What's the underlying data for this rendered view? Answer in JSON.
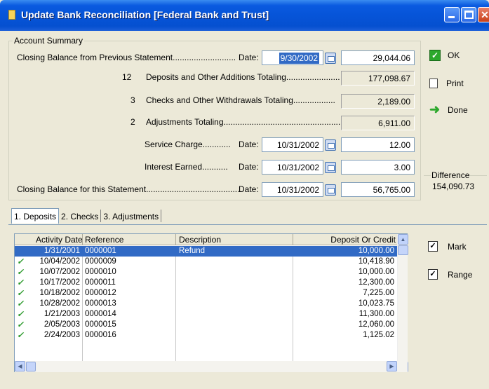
{
  "window": {
    "title": "Update Bank Reconciliation [Federal Bank and Trust]"
  },
  "summary": {
    "group_label": "Account Summary",
    "closing_prev_label": "Closing Balance from Previous Statement...........................",
    "date_label": "Date:",
    "closing_prev_date": "9/30/2002",
    "closing_prev_amount": "29,044.06",
    "deposits_count": "12",
    "deposits_label": "Deposits and Other Additions Totaling.......................",
    "deposits_total": "177,098.67",
    "checks_count": "3",
    "checks_label": "Checks and Other Withdrawals Totaling..................",
    "checks_total": "2,189.00",
    "adjustments_count": "2",
    "adjustments_label": "Adjustments Totaling...................................................",
    "adjustments_total": "6,911.00",
    "service_charge_label": "Service Charge............",
    "service_charge_date": "10/31/2002",
    "service_charge_amount": "12.00",
    "interest_label": "Interest Earned...........",
    "interest_date": "10/31/2002",
    "interest_amount": "3.00",
    "closing_this_label": "Closing Balance for this Statement.........................................",
    "closing_this_date": "10/31/2002",
    "closing_this_amount": "56,765.00"
  },
  "actions": {
    "ok": "OK",
    "print": "Print",
    "done": "Done"
  },
  "difference": {
    "label": "Difference",
    "value": "154,090.73"
  },
  "tabs": [
    {
      "label": "1. Deposits"
    },
    {
      "label": "2. Checks"
    },
    {
      "label": "3. Adjustments"
    }
  ],
  "grid": {
    "headers": {
      "activity_date": "Activity Date",
      "reference": "Reference",
      "description": "Description",
      "amount": "Deposit Or Credit"
    },
    "rows": [
      {
        "date": "1/31/2001",
        "ref": "0000001",
        "desc": "Refund",
        "amount": "10,000.00",
        "checked": false,
        "selected": true
      },
      {
        "date": "10/04/2002",
        "ref": "0000009",
        "desc": "",
        "amount": "10,418.90",
        "checked": true,
        "selected": false
      },
      {
        "date": "10/07/2002",
        "ref": "0000010",
        "desc": "",
        "amount": "10,000.00",
        "checked": true,
        "selected": false
      },
      {
        "date": "10/17/2002",
        "ref": "0000011",
        "desc": "",
        "amount": "12,300.00",
        "checked": true,
        "selected": false
      },
      {
        "date": "10/18/2002",
        "ref": "0000012",
        "desc": "",
        "amount": "7,225.00",
        "checked": true,
        "selected": false
      },
      {
        "date": "10/28/2002",
        "ref": "0000013",
        "desc": "",
        "amount": "10,023.75",
        "checked": true,
        "selected": false
      },
      {
        "date": "1/21/2003",
        "ref": "0000014",
        "desc": "",
        "amount": "11,300.00",
        "checked": true,
        "selected": false
      },
      {
        "date": "2/05/2003",
        "ref": "0000015",
        "desc": "",
        "amount": "12,060.00",
        "checked": true,
        "selected": false
      },
      {
        "date": "2/24/2003",
        "ref": "0000016",
        "desc": "",
        "amount": "1,125.02",
        "checked": true,
        "selected": false
      }
    ]
  },
  "side_actions": {
    "mark": "Mark",
    "range": "Range"
  }
}
